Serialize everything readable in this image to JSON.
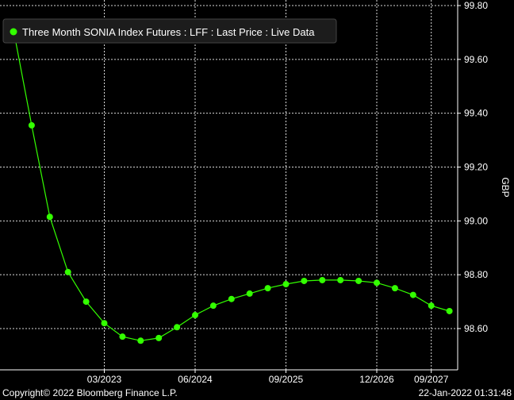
{
  "chart_data": {
    "type": "line",
    "legend": "Three Month SONIA Index Futures : LFF : Last Price : Live Data",
    "legend_placement": "top-left",
    "ylabel": "GBP",
    "ylim": [
      98.45,
      99.8
    ],
    "y_ticks": [
      98.6,
      98.8,
      99.0,
      99.2,
      99.4,
      99.6,
      99.8
    ],
    "y_tick_labels": [
      "98.60",
      "98.80",
      "99.00",
      "99.20",
      "99.40",
      "99.60",
      "99.80"
    ],
    "x_tick_labels": [
      "03/2023",
      "06/2024",
      "09/2025",
      "12/2026",
      "09/2027"
    ],
    "grid": true,
    "series": [
      {
        "color": "#33ff00",
        "values": [
          99.71,
          99.355,
          99.015,
          98.81,
          98.7,
          98.62,
          98.57,
          98.555,
          98.565,
          98.605,
          98.65,
          98.685,
          98.71,
          98.73,
          98.75,
          98.765,
          98.777,
          98.78,
          98.78,
          98.777,
          98.77,
          98.75,
          98.725,
          98.685,
          98.665
        ]
      }
    ],
    "footer_left": "Copyright© 2022 Bloomberg Finance L.P.",
    "footer_right": "22-Jan-2022 01:31:48"
  }
}
